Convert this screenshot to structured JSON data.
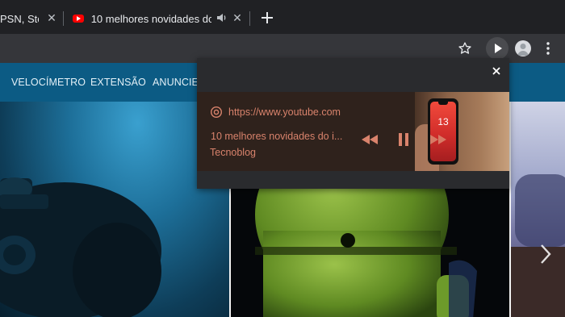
{
  "tabs": [
    {
      "title": "PSN, Ste"
    },
    {
      "title": "10 melhores novidades do"
    }
  ],
  "nav": [
    "VELOCÍMETRO",
    "EXTENSÃO",
    "ANUNCIE"
  ],
  "media": {
    "url": "https://www.youtube.com",
    "title": "10 melhores novidades do i...",
    "channel": "Tecnoblog",
    "phone_time": "13"
  },
  "colors": {
    "accent": "#d9836c",
    "navbar": "#0c5b84",
    "tabstrip": "#202124",
    "toolbar": "#35363a"
  }
}
